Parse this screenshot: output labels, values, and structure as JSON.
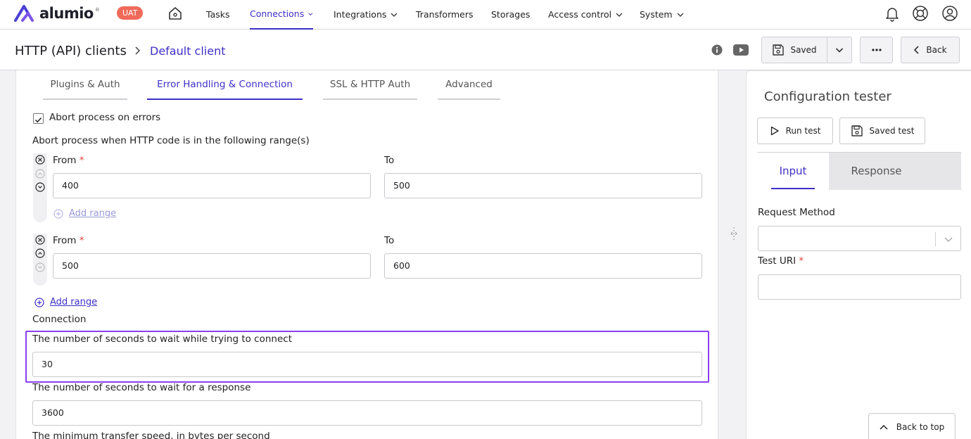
{
  "app": {
    "logo": "alumio",
    "env_badge": "UAT"
  },
  "nav": {
    "items": [
      {
        "label": "Tasks"
      },
      {
        "label": "Connections"
      },
      {
        "label": "Integrations"
      },
      {
        "label": "Transformers"
      },
      {
        "label": "Storages"
      },
      {
        "label": "Access control"
      },
      {
        "label": "System"
      }
    ],
    "active": "Connections"
  },
  "breadcrumb": {
    "root": "HTTP (API) clients",
    "current": "Default client"
  },
  "toolbar": {
    "saved_label": "Saved",
    "back_label": "Back"
  },
  "tabs": [
    {
      "label": "Plugins & Auth"
    },
    {
      "label": "Error Handling & Connection"
    },
    {
      "label": "SSL & HTTP Auth"
    },
    {
      "label": "Advanced"
    }
  ],
  "form": {
    "abort_checkbox_label": "Abort process on errors",
    "abort_checked": true,
    "range_heading": "Abort process when HTTP code is in the following range(s)",
    "from_label": "From",
    "to_label": "To",
    "required_mark": "*",
    "ranges": [
      {
        "from": "400",
        "to": "500"
      },
      {
        "from": "500",
        "to": "600"
      }
    ],
    "add_range_label": "Add range",
    "connection_heading": "Connection",
    "connect_timeout_label": "The number of seconds to wait while trying to connect",
    "connect_timeout_value": "30",
    "response_timeout_label": "The number of seconds to wait for a response",
    "response_timeout_value": "3600",
    "min_speed_label": "The minimum transfer speed, in bytes per second"
  },
  "tester": {
    "title": "Configuration tester",
    "run_test_label": "Run test",
    "saved_test_label": "Saved test",
    "tabs": [
      {
        "label": "Input"
      },
      {
        "label": "Response"
      }
    ],
    "request_method_label": "Request Method",
    "request_method_value": "",
    "test_uri_label": "Test URI",
    "test_uri_value": "",
    "back_to_top_label": "Back to top"
  },
  "colors": {
    "accent": "#3d2fc7",
    "badge": "#ef6a59",
    "highlight": "#8a3ff0",
    "required": "#e0463a"
  }
}
